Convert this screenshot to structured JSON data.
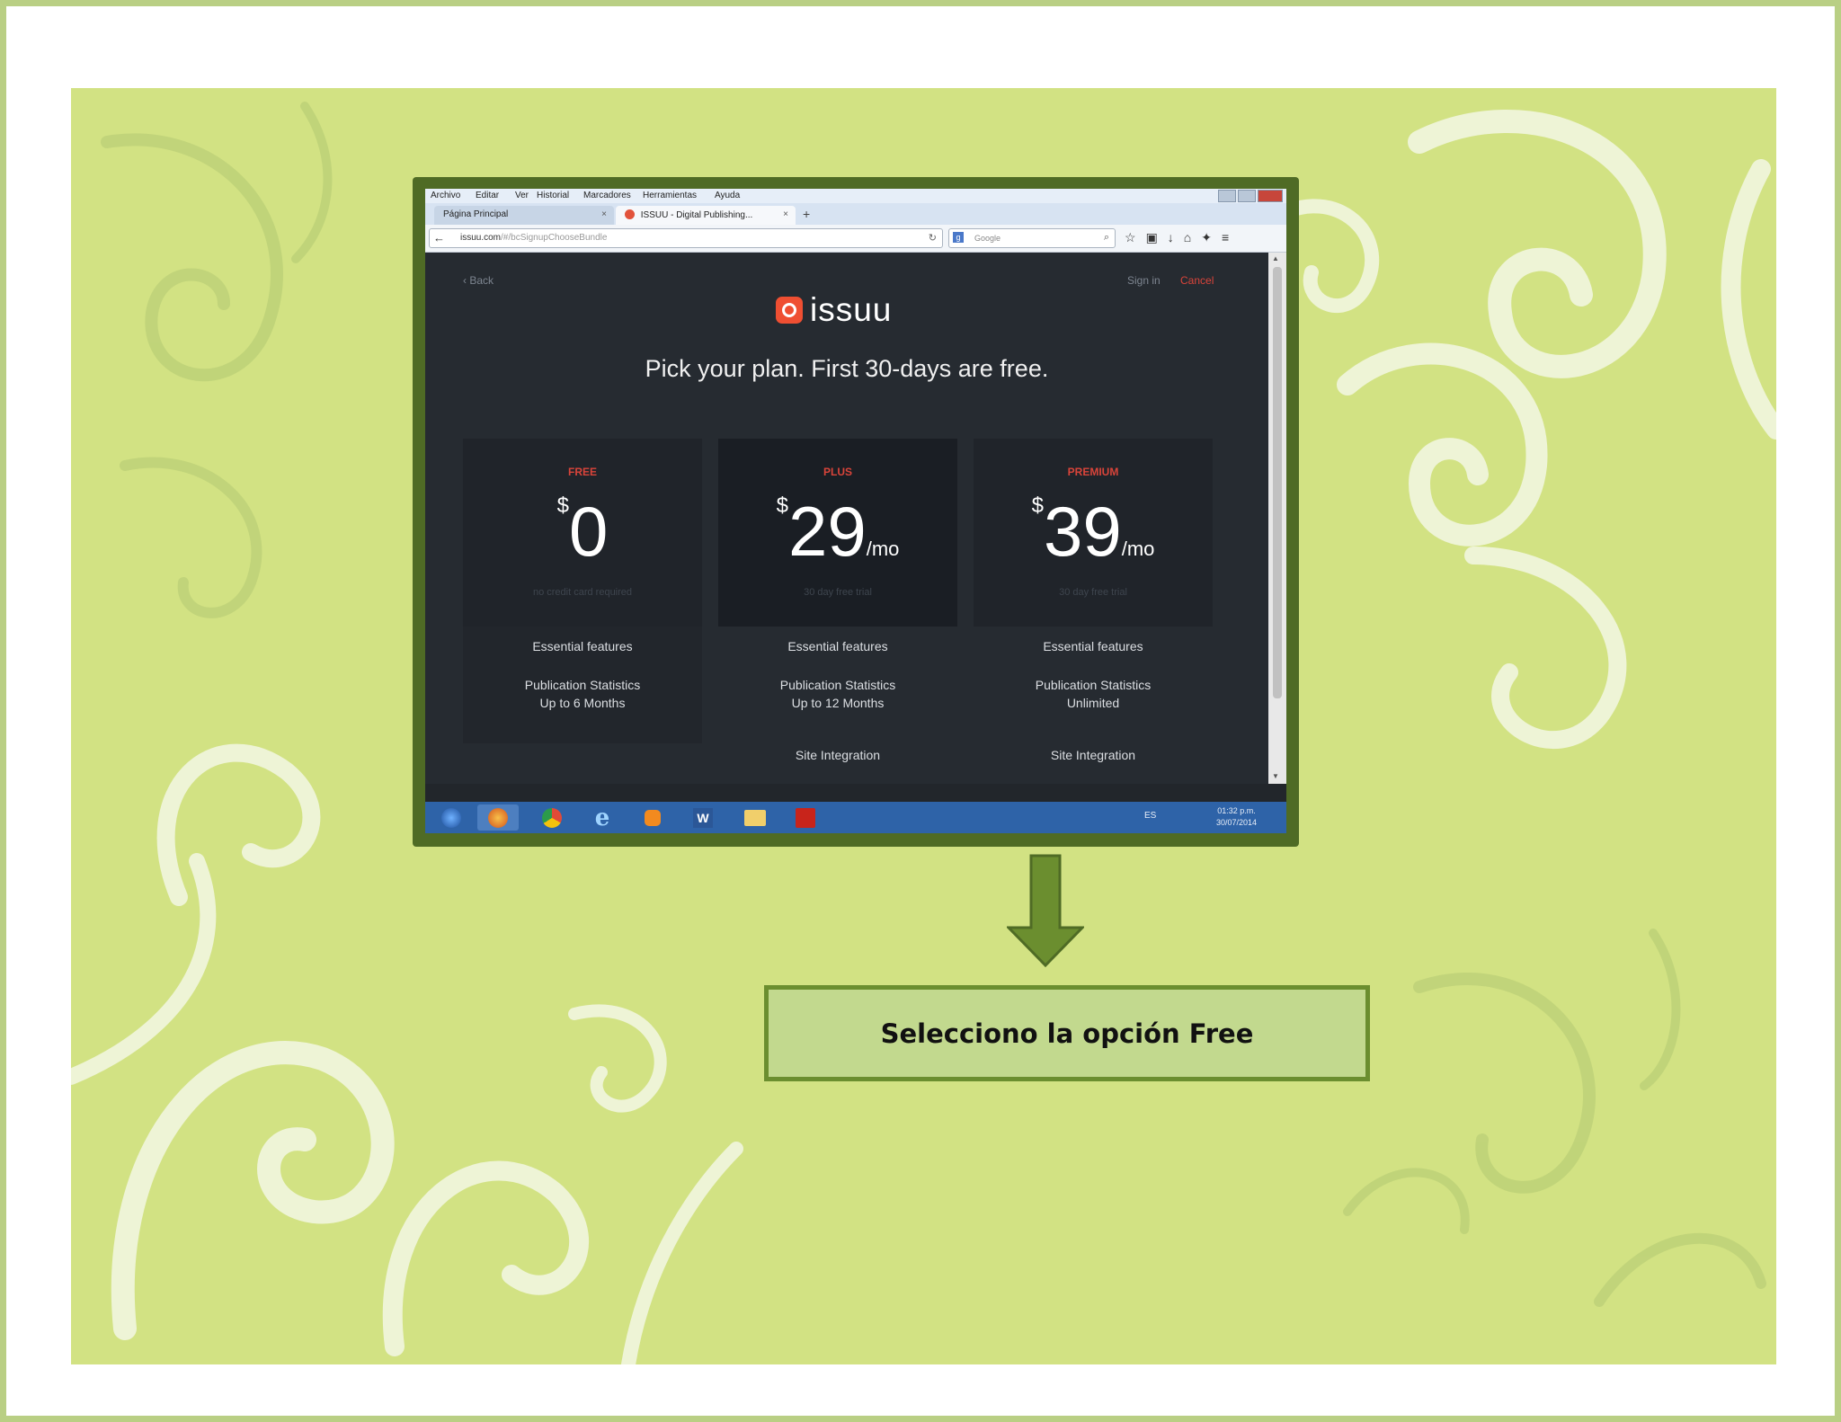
{
  "colors": {
    "slide_bg": "#d2e283",
    "frame_border": "#4f6b25",
    "caption_bg": "#c2d98e",
    "arrow": "#6b8e2f",
    "accent_red": "#d9443a"
  },
  "browser": {
    "menu": [
      "Archivo",
      "Editar",
      "Ver",
      "Historial",
      "Marcadores",
      "Herramientas",
      "Ayuda"
    ],
    "tabs": [
      {
        "label": "Página Principal",
        "close": "×"
      },
      {
        "label": "ISSUU - Digital Publishing...",
        "close": "×"
      }
    ],
    "new_tab": "+",
    "url_host": "issuu.com",
    "url_path": "/#/bcSignupChooseBundle",
    "search_engine": "Google",
    "toolbar_icons": [
      "star-icon",
      "clipboard-icon",
      "download-icon",
      "home-icon",
      "extension-icon",
      "menu-icon"
    ]
  },
  "page": {
    "back_label": "Back",
    "signin_label": "Sign in",
    "cancel_label": "Cancel",
    "logo_text": "issuu",
    "headline": "Pick your plan. First 30-days are free.",
    "plans": [
      {
        "name": "FREE",
        "currency": "$",
        "price": "0",
        "period": "",
        "subtitle": "no credit card required",
        "features": [
          "Essential features",
          "Publication Statistics",
          "Up to 6 Months"
        ]
      },
      {
        "name": "PLUS",
        "currency": "$",
        "price": "29",
        "period": "/mo",
        "subtitle": "30 day free trial",
        "features": [
          "Essential features",
          "Publication Statistics",
          "Up to 12 Months",
          "Site Integration"
        ]
      },
      {
        "name": "PREMIUM",
        "currency": "$",
        "price": "39",
        "period": "/mo",
        "subtitle": "30 day free trial",
        "features": [
          "Essential features",
          "Publication Statistics",
          "Unlimited",
          "Site Integration"
        ]
      }
    ]
  },
  "taskbar": {
    "apps": [
      "start-orb-icon",
      "firefox-icon",
      "chrome-icon",
      "internet-explorer-icon",
      "media-player-icon",
      "word-icon",
      "file-explorer-icon",
      "acrobat-icon"
    ],
    "language": "ES",
    "time": "01:32 p.m.",
    "date": "30/07/2014"
  },
  "caption": "Selecciono la opción Free"
}
